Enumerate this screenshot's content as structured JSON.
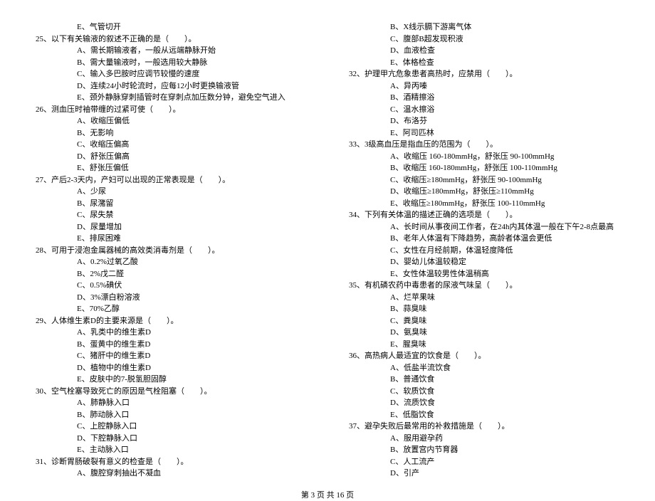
{
  "left": {
    "q24e": "E、气管切开",
    "q25": "25、以下有关输液的叙述不正确的是（　　）。",
    "q25a": "A、需长期输液者，一般从远端静脉开始",
    "q25b": "B、需大量输液时，一般选用较大静脉",
    "q25c": "C、输入多巴胺时应调节较慢的速度",
    "q25d": "D、连续24小时轮流时，应每12小时更换输液管",
    "q25e": "E、颈外静脉穿刺插管时在穿刺点加压数分钟，避免空气进入",
    "q26": "26、测血压时袖带缠的过紧可使（　　）。",
    "q26a": "A、收缩压偏低",
    "q26b": "B、无影响",
    "q26c": "C、收缩压偏高",
    "q26d": "D、舒张压偏高",
    "q26e": "E、舒张压偏低",
    "q27": "27、产后2-3天内，产妇可以出现的正常表现是（　　）。",
    "q27a": "A、少尿",
    "q27b": "B、尿潴留",
    "q27c": "C、尿失禁",
    "q27d": "D、尿量增加",
    "q27e": "E、排尿困难",
    "q28": "28、可用于浸泡金属器械的高效类消毒剂是（　　）。",
    "q28a": "A、0.2%过氧乙酸",
    "q28b": "B、2%戊二醛",
    "q28c": "C、0.5%碘伏",
    "q28d": "D、3%漂白粉溶液",
    "q28e": "E、70%乙醇",
    "q29": "29、人体维生素D的主要来源是（　　）。",
    "q29a": "A、乳类中的维生素D",
    "q29b": "B、蛋黄中的维生素D",
    "q29c": "C、猪肝中的维生素D",
    "q29d": "D、植物中的维生素D",
    "q29e": "E、皮肤中的7-脱氢胆固醇",
    "q30": "30、空气栓塞导致死亡的原因是气栓阻塞（　　）。",
    "q30a": "A、肺静脉入口",
    "q30b": "B、肺动脉入口",
    "q30c": "C、上腔静脉入口",
    "q30d": "D、下腔静脉入口",
    "q30e": "E、主动脉入口",
    "q31": "31、诊断胃肠破裂有意义的检查是（　　）。",
    "q31a": "A、腹腔穿刺抽出不凝血"
  },
  "right": {
    "q31b": "B、X线示膈下游离气体",
    "q31c": "C、腹部B超发现积液",
    "q31d": "D、血液检查",
    "q31e": "E、体格检查",
    "q32": "32、护理甲亢危象患者高热时，应禁用（　　）。",
    "q32a": "A、异丙嗪",
    "q32b": "B、酒精擦浴",
    "q32c": "C、温水擦浴",
    "q32d": "D、布洛芬",
    "q32e": "E、阿司匹林",
    "q33": "33、3级高血压是指血压的范围为（　　）。",
    "q33a": "A、收缩压 160-180mmHg，舒张压 90-100mmHg",
    "q33b": "B、收缩压 160-180mmHg，舒张压 100-110mmHg",
    "q33c": "C、收缩压≥180mmHg，舒张压 90-100mmHg",
    "q33d": "D、收缩压≥180mmHg，舒张压≥110mmHg",
    "q33e": "E、收缩压≥180mmHg，舒张压 100-110mmHg",
    "q34": "34、下列有关体温的描述正确的选项是（　　）。",
    "q34a": "A、长时间从事夜间工作者，在24h内其体温一般在下午2-8点最高",
    "q34b": "B、老年人体温有下降趋势，高龄者体温会更低",
    "q34c": "C、女性在月经前期，体温轻度降低",
    "q34d": "D、婴幼儿体温较稳定",
    "q34e": "E、女性体温较男性体温稍高",
    "q35": "35、有机磷农药中毒患者的尿液气味呈（　　）。",
    "q35a": "A、烂苹果味",
    "q35b": "B、蒜臭味",
    "q35c": "C、粪臭味",
    "q35d": "D、氨臭味",
    "q35e": "E、腥臭味",
    "q36": "36、高热病人最适宜的饮食是（　　）。",
    "q36a": "A、低盐半流饮食",
    "q36b": "B、普通饮食",
    "q36c": "C、软质饮食",
    "q36d": "D、流质饮食",
    "q36e": "E、低脂饮食",
    "q37": "37、避孕失败后最常用的补救措施是（　　）。",
    "q37a": "A、服用避孕药",
    "q37b": "B、放置宫内节育器",
    "q37c": "C、人工流产",
    "q37d": "D、引产"
  },
  "footer": "第 3 页 共 16 页"
}
